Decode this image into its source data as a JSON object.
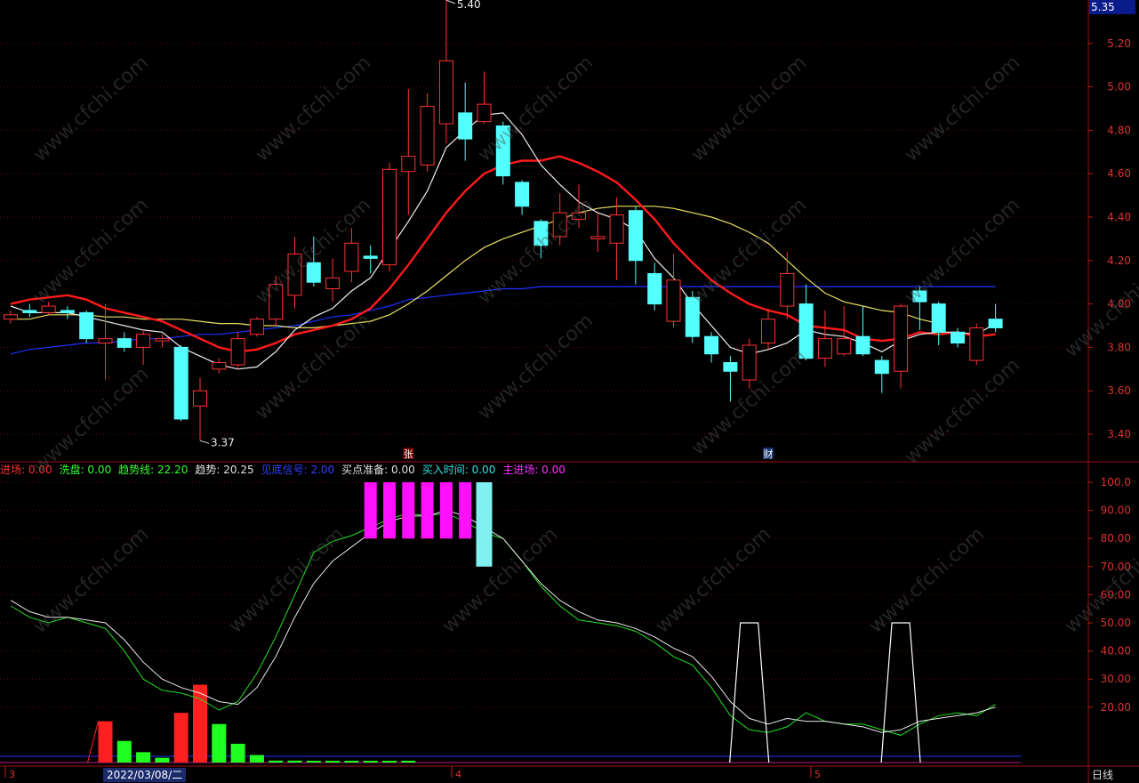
{
  "current_price": "5.35",
  "period_label": "日线",
  "cursor_date": "2022/03/08/二",
  "x_axis_ticks": [
    "3",
    "4",
    "5"
  ],
  "markers": {
    "zhang": "张",
    "cai": "财"
  },
  "extremes": {
    "high": "5.40",
    "low": "3.37"
  },
  "watermark": "www.cfchi.com",
  "legend": [
    {
      "label": "进场:",
      "value": "0.00",
      "color": "#ff3030"
    },
    {
      "label": "洗盘:",
      "value": "0.00",
      "color": "#30ff30"
    },
    {
      "label": "趋势线:",
      "value": "22.20",
      "color": "#30ff30"
    },
    {
      "label": "趋势:",
      "value": "20.25",
      "color": "#e0e0e0"
    },
    {
      "label": "见底信号:",
      "value": "2.00",
      "color": "#3040ff"
    },
    {
      "label": "买点准备:",
      "value": "0.00",
      "color": "#e0e0e0"
    },
    {
      "label": "买入时间:",
      "value": "0.00",
      "color": "#30e0e0"
    },
    {
      "label": "主进场:",
      "value": "0.00",
      "color": "#ff30ff"
    }
  ],
  "chart_data": [
    {
      "type": "candlestick",
      "price_axis": {
        "ylim": [
          3.3,
          5.4
        ],
        "ticks": [
          "5.20",
          "5.00",
          "4.80",
          "4.60",
          "4.40",
          "4.20",
          "4.00",
          "3.80",
          "3.60",
          "3.40"
        ]
      },
      "candles": [
        {
          "o": 3.93,
          "c": 3.95,
          "h": 3.97,
          "l": 3.91
        },
        {
          "o": 3.97,
          "c": 3.96,
          "h": 4.0,
          "l": 3.94
        },
        {
          "o": 3.96,
          "c": 3.99,
          "h": 4.01,
          "l": 3.95
        },
        {
          "o": 3.97,
          "c": 3.96,
          "h": 3.99,
          "l": 3.93
        },
        {
          "o": 3.96,
          "c": 3.84,
          "h": 3.97,
          "l": 3.82
        },
        {
          "o": 3.82,
          "c": 3.84,
          "h": 4.0,
          "l": 3.65
        },
        {
          "o": 3.84,
          "c": 3.8,
          "h": 3.87,
          "l": 3.78
        },
        {
          "o": 3.8,
          "c": 3.86,
          "h": 3.88,
          "l": 3.72
        },
        {
          "o": 3.83,
          "c": 3.84,
          "h": 3.86,
          "l": 3.8
        },
        {
          "o": 3.8,
          "c": 3.47,
          "h": 3.81,
          "l": 3.46
        },
        {
          "o": 3.53,
          "c": 3.6,
          "h": 3.66,
          "l": 3.37
        },
        {
          "o": 3.7,
          "c": 3.73,
          "h": 3.75,
          "l": 3.68
        },
        {
          "o": 3.72,
          "c": 3.84,
          "h": 3.87,
          "l": 3.7
        },
        {
          "o": 3.86,
          "c": 3.93,
          "h": 3.94,
          "l": 3.85
        },
        {
          "o": 3.93,
          "c": 4.09,
          "h": 4.13,
          "l": 3.9
        },
        {
          "o": 4.04,
          "c": 4.23,
          "h": 4.31,
          "l": 3.98
        },
        {
          "o": 4.19,
          "c": 4.1,
          "h": 4.31,
          "l": 4.08
        },
        {
          "o": 4.07,
          "c": 4.12,
          "h": 4.21,
          "l": 4.01
        },
        {
          "o": 4.15,
          "c": 4.28,
          "h": 4.35,
          "l": 4.1
        },
        {
          "o": 4.22,
          "c": 4.21,
          "h": 4.27,
          "l": 4.14
        },
        {
          "o": 4.18,
          "c": 4.62,
          "h": 4.65,
          "l": 4.15
        },
        {
          "o": 4.61,
          "c": 4.68,
          "h": 4.99,
          "l": 4.41
        },
        {
          "o": 4.64,
          "c": 4.91,
          "h": 4.97,
          "l": 4.61
        },
        {
          "o": 4.83,
          "c": 5.12,
          "h": 5.4,
          "l": 4.74
        },
        {
          "o": 4.88,
          "c": 4.76,
          "h": 5.02,
          "l": 4.66
        },
        {
          "o": 4.84,
          "c": 4.92,
          "h": 5.07,
          "l": 4.83
        },
        {
          "o": 4.82,
          "c": 4.59,
          "h": 4.84,
          "l": 4.55
        },
        {
          "o": 4.56,
          "c": 4.45,
          "h": 4.57,
          "l": 4.41
        },
        {
          "o": 4.38,
          "c": 4.27,
          "h": 4.39,
          "l": 4.21
        },
        {
          "o": 4.31,
          "c": 4.42,
          "h": 4.51,
          "l": 4.27
        },
        {
          "o": 4.39,
          "c": 4.42,
          "h": 4.55,
          "l": 4.35
        },
        {
          "o": 4.3,
          "c": 4.31,
          "h": 4.42,
          "l": 4.24
        },
        {
          "o": 4.28,
          "c": 4.41,
          "h": 4.49,
          "l": 4.11
        },
        {
          "o": 4.43,
          "c": 4.2,
          "h": 4.45,
          "l": 4.09
        },
        {
          "o": 4.14,
          "c": 4.0,
          "h": 4.19,
          "l": 3.97
        },
        {
          "o": 3.92,
          "c": 4.11,
          "h": 4.23,
          "l": 3.89
        },
        {
          "o": 4.03,
          "c": 3.85,
          "h": 4.06,
          "l": 3.82
        },
        {
          "o": 3.85,
          "c": 3.77,
          "h": 3.87,
          "l": 3.73
        },
        {
          "o": 3.73,
          "c": 3.69,
          "h": 3.76,
          "l": 3.55
        },
        {
          "o": 3.65,
          "c": 3.81,
          "h": 3.84,
          "l": 3.61
        },
        {
          "o": 3.82,
          "c": 3.93,
          "h": 3.98,
          "l": 3.79
        },
        {
          "o": 3.99,
          "c": 4.14,
          "h": 4.24,
          "l": 3.93
        },
        {
          "o": 4.0,
          "c": 3.75,
          "h": 4.09,
          "l": 3.74
        },
        {
          "o": 3.75,
          "c": 3.84,
          "h": 3.97,
          "l": 3.71
        },
        {
          "o": 3.77,
          "c": 3.84,
          "h": 3.99,
          "l": 3.76
        },
        {
          "o": 3.85,
          "c": 3.77,
          "h": 3.99,
          "l": 3.76
        },
        {
          "o": 3.74,
          "c": 3.68,
          "h": 3.76,
          "l": 3.59
        },
        {
          "o": 3.69,
          "c": 3.99,
          "h": 4.0,
          "l": 3.61
        },
        {
          "o": 4.06,
          "c": 4.01,
          "h": 4.08,
          "l": 3.88
        },
        {
          "o": 4.0,
          "c": 3.87,
          "h": 4.01,
          "l": 3.81
        },
        {
          "o": 3.87,
          "c": 3.82,
          "h": 3.89,
          "l": 3.8
        },
        {
          "o": 3.74,
          "c": 3.89,
          "h": 3.91,
          "l": 3.72
        },
        {
          "o": 3.93,
          "c": 3.89,
          "h": 4.0,
          "l": 3.87
        }
      ],
      "ma_white": [
        3.99,
        3.96,
        3.96,
        3.96,
        3.94,
        3.92,
        3.9,
        3.88,
        3.87,
        3.8,
        3.76,
        3.72,
        3.7,
        3.71,
        3.78,
        3.88,
        3.94,
        3.98,
        4.06,
        4.12,
        4.25,
        4.38,
        4.52,
        4.72,
        4.8,
        4.87,
        4.88,
        4.78,
        4.64,
        4.55,
        4.47,
        4.42,
        4.39,
        4.34,
        4.21,
        4.12,
        4.0,
        3.9,
        3.8,
        3.77,
        3.79,
        3.82,
        3.88,
        3.86,
        3.85,
        3.82,
        3.78,
        3.83,
        3.86,
        3.87,
        3.87,
        3.86,
        3.91
      ],
      "ma_red": [
        4.0,
        4.02,
        4.03,
        4.04,
        4.02,
        3.98,
        3.96,
        3.94,
        3.92,
        3.88,
        3.84,
        3.8,
        3.78,
        3.79,
        3.82,
        3.86,
        3.88,
        3.9,
        3.93,
        3.98,
        4.07,
        4.18,
        4.3,
        4.42,
        4.52,
        4.6,
        4.64,
        4.66,
        4.66,
        4.68,
        4.65,
        4.61,
        4.56,
        4.48,
        4.39,
        4.28,
        4.19,
        4.11,
        4.05,
        4.0,
        3.97,
        3.95,
        3.9,
        3.89,
        3.88,
        3.84,
        3.83,
        3.84,
        3.87,
        3.86,
        3.87,
        3.85,
        3.86
      ],
      "ma_yellow": [
        3.93,
        3.93,
        3.95,
        3.95,
        3.95,
        3.94,
        3.94,
        3.93,
        3.93,
        3.93,
        3.92,
        3.91,
        3.91,
        3.9,
        3.9,
        3.89,
        3.89,
        3.9,
        3.91,
        3.92,
        3.95,
        4.0,
        4.06,
        4.13,
        4.2,
        4.26,
        4.3,
        4.33,
        4.36,
        4.39,
        4.42,
        4.44,
        4.45,
        4.45,
        4.45,
        4.44,
        4.42,
        4.4,
        4.37,
        4.33,
        4.28,
        4.2,
        4.12,
        4.05,
        4.01,
        3.99,
        3.97,
        3.96,
        3.93,
        3.91
      ],
      "ma_blue": [
        3.77,
        3.79,
        3.8,
        3.81,
        3.82,
        3.82,
        3.83,
        3.84,
        3.84,
        3.85,
        3.86,
        3.86,
        3.87,
        3.88,
        3.89,
        3.9,
        3.92,
        3.94,
        3.95,
        3.97,
        3.99,
        4.02,
        4.03,
        4.04,
        4.05,
        4.06,
        4.07,
        4.07,
        4.08,
        4.08,
        4.08,
        4.08,
        4.08,
        4.08,
        4.08,
        4.08,
        4.08,
        4.08,
        4.08,
        4.08,
        4.08,
        4.08,
        4.08,
        4.08,
        4.08,
        4.08,
        4.08,
        4.08,
        4.08,
        4.08,
        4.08,
        4.08,
        4.08
      ]
    },
    {
      "type": "indicator",
      "ylim": [
        0,
        100
      ],
      "ticks": [
        "100.0",
        "90.00",
        "80.00",
        "70.00",
        "60.00",
        "50.00",
        "40.00",
        "30.00",
        "20.00"
      ],
      "trend_white": [
        58,
        54,
        52,
        52,
        51,
        50,
        44,
        36,
        30,
        27,
        25,
        22,
        21,
        27,
        38,
        52,
        64,
        72,
        77,
        82,
        86,
        88,
        88,
        90,
        88,
        84,
        80,
        72,
        64,
        58,
        54,
        51,
        50,
        48,
        45,
        41,
        38,
        31,
        22,
        16,
        14,
        16,
        15,
        15,
        14,
        13,
        11,
        12,
        15,
        16,
        17,
        18,
        20
      ],
      "trend_green": [
        56,
        52,
        50,
        52,
        50,
        48,
        40,
        30,
        26,
        25,
        23,
        19,
        22,
        32,
        45,
        60,
        75,
        79,
        81,
        84,
        87,
        89,
        88,
        89,
        86,
        82,
        80,
        72,
        63,
        56,
        51,
        50,
        49,
        47,
        43,
        38,
        35,
        27,
        17,
        12,
        11,
        13,
        18,
        15,
        14,
        14,
        12,
        10,
        14,
        17,
        18,
        17,
        21
      ],
      "entry_red": [
        0,
        0,
        0,
        0,
        0,
        15,
        0,
        0,
        0,
        18,
        28,
        0,
        0,
        0,
        0,
        0,
        0,
        0,
        0,
        0,
        0,
        0,
        0,
        0,
        0,
        0,
        0,
        0,
        0,
        0,
        0,
        0,
        0,
        0,
        0,
        0,
        0,
        0,
        0,
        0,
        0,
        0,
        0,
        0,
        0,
        0,
        0,
        0,
        0,
        0,
        0,
        0,
        0
      ],
      "wash_green": [
        0,
        0,
        0,
        0,
        0,
        0,
        8,
        4,
        2,
        0,
        0,
        14,
        7,
        3,
        1,
        1,
        0,
        0,
        0,
        0,
        0,
        0,
        0,
        0,
        0,
        0,
        0,
        0,
        0,
        0,
        0,
        0,
        0,
        0,
        0,
        0,
        0,
        0,
        0,
        0,
        0,
        0,
        0,
        0,
        0,
        0,
        0,
        0,
        0,
        0,
        0,
        0,
        0
      ],
      "main_magenta_bars": [
        19,
        20,
        21,
        22,
        23,
        24
      ],
      "buy_cyan_bar": 25,
      "bottom_signal_spikes": [
        39,
        47
      ]
    }
  ]
}
